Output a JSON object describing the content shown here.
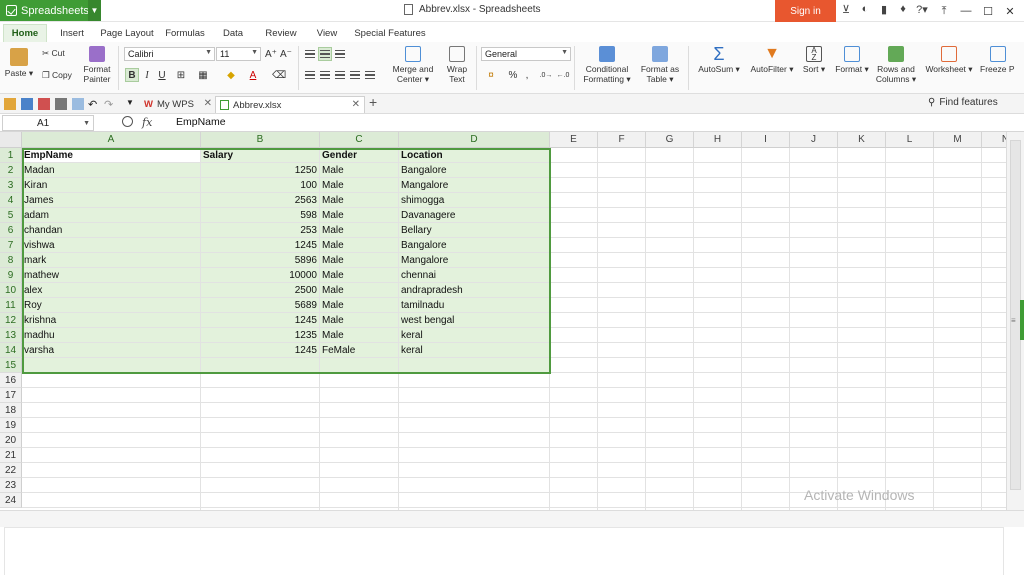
{
  "app": {
    "name": "Spreadsheets",
    "doc_title": "Abbrev.xlsx - Spreadsheets",
    "signin": "Sign in",
    "title_icons": [
      "cart-icon",
      "skin-icon",
      "bookmark-icon",
      "shirt-icon",
      "help-icon"
    ],
    "help_label": "?"
  },
  "menu": {
    "tabs": [
      "Home",
      "Insert",
      "Page Layout",
      "Formulas",
      "Data",
      "Review",
      "View",
      "Special Features"
    ],
    "active": "Home"
  },
  "ribbon": {
    "paste": "Paste",
    "cut": "Cut",
    "copy": "Copy",
    "format_painter": [
      "Format",
      "Painter"
    ],
    "font_name": "Calibri",
    "font_size": "11",
    "merge_center": [
      "Merge and",
      "Center"
    ],
    "wrap_text": [
      "Wrap",
      "Text"
    ],
    "number_format": "General",
    "percent": "%",
    "comma": ",",
    "conditional_formatting": [
      "Conditional",
      "Formatting"
    ],
    "format_as_table": [
      "Format as",
      "Table"
    ],
    "autosum": "AutoSum",
    "autofilter": "AutoFilter",
    "sort": "Sort",
    "format": "Format",
    "rows_columns": [
      "Rows and",
      "Columns"
    ],
    "worksheet": "Worksheet",
    "freeze": "Freeze P"
  },
  "quickbar": {
    "tabs": [
      {
        "label": "My WPS"
      },
      {
        "label": "Abbrev.xlsx"
      }
    ],
    "find": "Find features",
    "new_tab": "+"
  },
  "formula_bar": {
    "cell_ref": "A1",
    "fx": "fx",
    "value": "EmpName"
  },
  "sheet": {
    "columns": [
      "A",
      "B",
      "C",
      "D",
      "E",
      "F",
      "G",
      "H",
      "I",
      "J",
      "K",
      "L",
      "M",
      "N"
    ],
    "row_numbers": [
      "1",
      "2",
      "3",
      "4",
      "5",
      "6",
      "7",
      "8",
      "9",
      "10",
      "11",
      "12",
      "13",
      "14",
      "15",
      "16",
      "17",
      "18",
      "19",
      "20",
      "21",
      "22",
      "23",
      "24"
    ],
    "header": [
      "EmpName",
      "Salary",
      "Gender",
      "Location"
    ],
    "rows": [
      [
        "Madan",
        "1250",
        "Male",
        "Bangalore"
      ],
      [
        "Kiran",
        "100",
        "Male",
        "Mangalore"
      ],
      [
        "James",
        "2563",
        "Male",
        "shimogga"
      ],
      [
        "adam",
        "598",
        "Male",
        "Davanagere"
      ],
      [
        "chandan",
        "253",
        "Male",
        "Bellary"
      ],
      [
        "vishwa",
        "1245",
        "Male",
        "Bangalore"
      ],
      [
        "mark",
        "5896",
        "Male",
        "Mangalore"
      ],
      [
        "mathew",
        "10000",
        "Male",
        "chennai"
      ],
      [
        "alex",
        "2500",
        "Male",
        "andrapradesh"
      ],
      [
        "Roy",
        "5689",
        "Male",
        "tamilnadu"
      ],
      [
        "krishna",
        "1245",
        "Male",
        "west bengal"
      ],
      [
        "madhu",
        "1235",
        "Male",
        "keral"
      ],
      [
        "varsha",
        "1245",
        "FeMale",
        "keral"
      ]
    ]
  },
  "watermark": "Activate Windows",
  "colors": {
    "brand": "#3f9c35",
    "signin": "#e8572f",
    "selection": "#e3f2dc",
    "selection_border": "#4f9a3f"
  }
}
